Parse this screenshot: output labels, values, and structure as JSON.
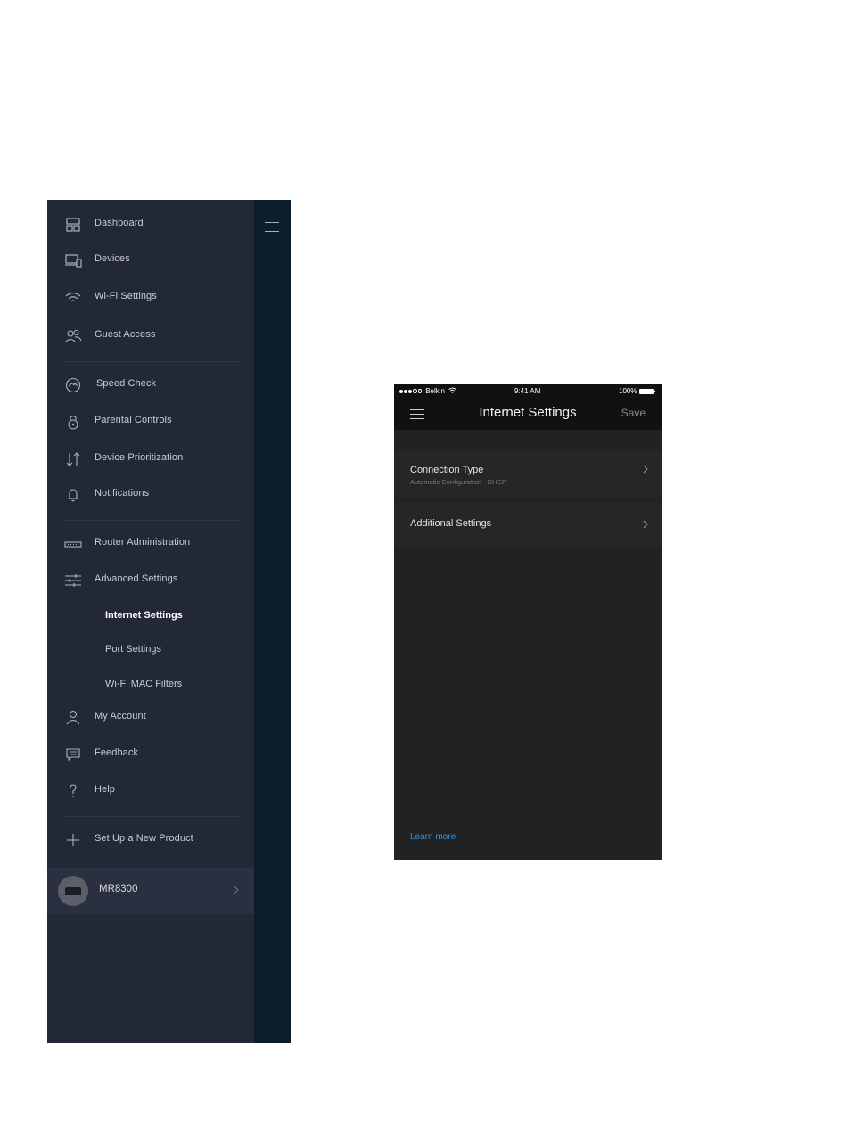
{
  "drawer": {
    "nav_items": [
      {
        "label": "Dashboard",
        "icon": "dashboard-icon"
      },
      {
        "label": "Devices",
        "icon": "devices-icon"
      },
      {
        "label": "Wi-Fi Settings",
        "icon": "wifi-icon"
      },
      {
        "label": "Guest Access",
        "icon": "guest-icon"
      },
      {
        "label": "Speed Check",
        "icon": "speedometer-icon"
      },
      {
        "label": "Parental Controls",
        "icon": "lock-icon"
      },
      {
        "label": "Device Prioritization",
        "icon": "priority-arrows-icon"
      },
      {
        "label": "Notifications",
        "icon": "bell-icon"
      },
      {
        "label": "Router Administration",
        "icon": "router-icon"
      },
      {
        "label": "Advanced Settings",
        "icon": "sliders-icon"
      },
      {
        "label": "My Account",
        "icon": "person-icon"
      },
      {
        "label": "Feedback",
        "icon": "chat-icon"
      },
      {
        "label": "Help",
        "icon": "question-icon"
      },
      {
        "label": "Set Up a New Product",
        "icon": "plus-icon"
      }
    ],
    "sub_items": [
      {
        "label": "Internet Settings",
        "active": true
      },
      {
        "label": "Port Settings",
        "active": false
      },
      {
        "label": "Wi-Fi MAC Filters",
        "active": false
      }
    ],
    "device": {
      "name": "MR8300"
    }
  },
  "phone": {
    "status": {
      "carrier": "Belkin",
      "time": "9:41 AM",
      "battery": "100%"
    },
    "title": "Internet Settings",
    "save_label": "Save",
    "connection": {
      "title": "Connection Type",
      "subtitle": "Automatic Configuration - DHCP"
    },
    "additional": {
      "title": "Additional Settings"
    },
    "learn_more": "Learn more"
  },
  "colors": {
    "drawer_bg": "#232836",
    "strip_bg": "#0b1d2c",
    "screen_bg": "#222222",
    "link": "#3a8fd6"
  }
}
